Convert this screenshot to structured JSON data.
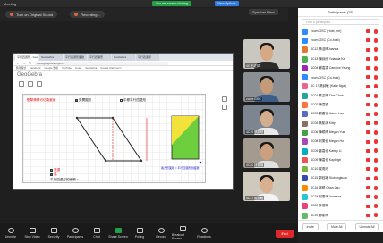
{
  "window": {
    "title": "Meeting"
  },
  "share_banner": "You are screen sharing",
  "view_options": "View Options",
  "subbar": {
    "original_sound": "Turn on Original Sound",
    "recording": "Recording...",
    "speaker_view": "Speaker View"
  },
  "browser": {
    "tabs": [
      "平行四邊形 - GeoGebra",
      "GeoGebra",
      "平行四邊形面積",
      "平行四邊形",
      "GeoGebra",
      "平行四邊形"
    ],
    "url": "www.geogebra.org/m/...",
    "bookmarks": [
      "應用程式",
      "Facebook",
      "Google 雲端",
      "YouTube",
      "Gmail",
      "GeoGebra",
      "Google Classroom"
    ]
  },
  "geogebra": {
    "logo": "GeoGebra",
    "label_red": "點擊滑桿可切換畫面",
    "label_cut": "剪開圖形",
    "label_rect": "平移平行四邊形",
    "label_bottom1": "底邊",
    "label_bottom2": "高",
    "label_bottom3": "平行四邊形的面積 =",
    "label_blue": "長方形面積 = 平行四邊形的面積"
  },
  "tiles": [
    {
      "name": "4C 石老師",
      "face": "#d7a886",
      "shirt": "#2b2b2b",
      "bg": "#c9c7c0"
    },
    {
      "name": "zoom GSC",
      "face": "#c49a7a",
      "shirt": "#3b5f8a",
      "bg": "#8b8e93"
    },
    {
      "name": "4C19 鄧凱晴",
      "face": "#d4ad8c",
      "shirt": "#e9e9e9",
      "bg": "#7d8590"
    },
    {
      "name": "4C20 林雅琳",
      "face": "#caa080",
      "shirt": "#e0e0e0",
      "bg": "#a39b90"
    },
    {
      "name": "4C17 黃詩敏",
      "face": "#d8b090",
      "shirt": "#f3f3f3",
      "bg": "#cfc8bc"
    },
    {
      "name": "4C03 劉嘉怡",
      "face": "#caa07f",
      "shirt": "#e8e8e8",
      "bg": "#bdb5a6"
    }
  ],
  "participants": {
    "header": "Participants (28)",
    "find": "Find a participant",
    "list": [
      {
        "name": "zoom GSC (Host, me)",
        "color": "#2d8cff"
      },
      {
        "name": "zoom GSC (Co-host)",
        "color": "#2d8cff"
      },
      {
        "name": "4C12 黃浩晴Joanna",
        "color": "#e07a2f"
      },
      {
        "name": "4C13 陳詠欣 Yolanda Ka",
        "color": "#4caf50"
      },
      {
        "name": "4C04 蘇嘉雯 Candice Yeung",
        "color": "#9c27b0"
      },
      {
        "name": "zoom GSC (Co-host)",
        "color": "#2d8cff"
      },
      {
        "name": "4C 17 黃詩敏 (Katie Ngai)",
        "color": "#f06292"
      },
      {
        "name": "4C01 蔡芷晴 Tina Chan",
        "color": "#26a69a"
      },
      {
        "name": "4C02 陳嘉穎",
        "color": "#ff7043"
      },
      {
        "name": "4C03 劉嘉怡 Jaime Lau",
        "color": "#5c6bc0"
      },
      {
        "name": "4C05 黃凱琪 Kitty",
        "color": "#8d6e63"
      },
      {
        "name": "4C06 陳曉晴 Megan Yue",
        "color": "#43a047"
      },
      {
        "name": "4C08 何樂怡 Megan Ho",
        "color": "#ab47bc"
      },
      {
        "name": "4C09 曾嘉怡 Karley Li",
        "color": "#00acc1"
      },
      {
        "name": "4C09 陳嘉怡 Kayleigh",
        "color": "#ef5350"
      },
      {
        "name": "4C10 梁燕玲",
        "color": "#7cb342"
      },
      {
        "name": "4C15 郭鈺瑤 Siobongkuan",
        "color": "#3949ab"
      },
      {
        "name": "4C16 姚曉 Chan Lau",
        "color": "#fb8c00"
      },
      {
        "name": "4C18 何思琪 Vanessa",
        "color": "#26c6da"
      },
      {
        "name": "4C20 林雅琳",
        "color": "#ec407a"
      },
      {
        "name": "4C19 鄧凱晴",
        "color": "#66bb6a"
      }
    ],
    "invite": "Invite",
    "mute_all": "Mute All",
    "unmute_all": "Unmute All"
  },
  "toolbar": {
    "items": [
      "Unmute",
      "Stop Video",
      "Security",
      "Participants",
      "Chat",
      "Share Screen",
      "Polling",
      "Record",
      "Breakout Rooms",
      "Reactions"
    ],
    "participants_count": "28",
    "end": "End"
  }
}
